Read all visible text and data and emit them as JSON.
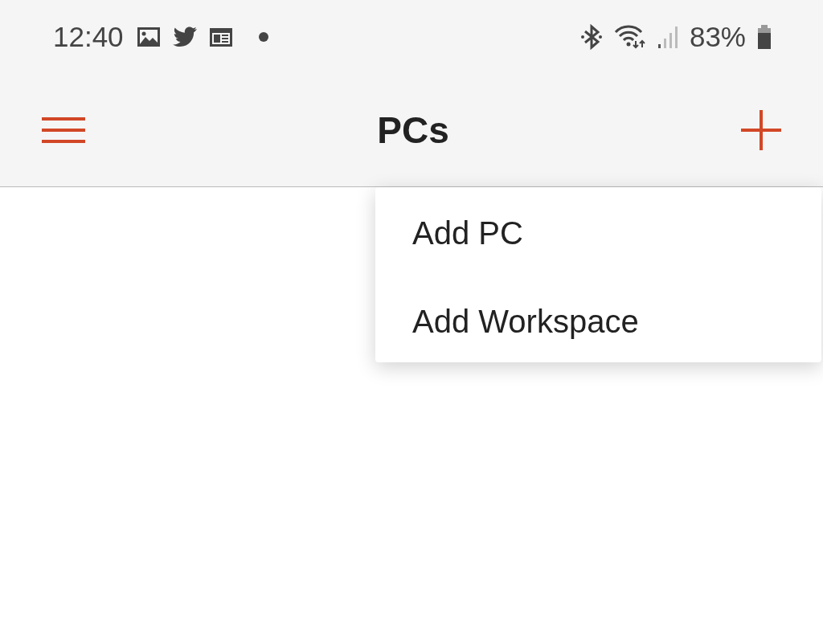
{
  "status_bar": {
    "time": "12:40",
    "battery": "83%"
  },
  "toolbar": {
    "title": "PCs"
  },
  "menu": {
    "items": [
      {
        "label": "Add PC"
      },
      {
        "label": "Add Workspace"
      }
    ]
  }
}
